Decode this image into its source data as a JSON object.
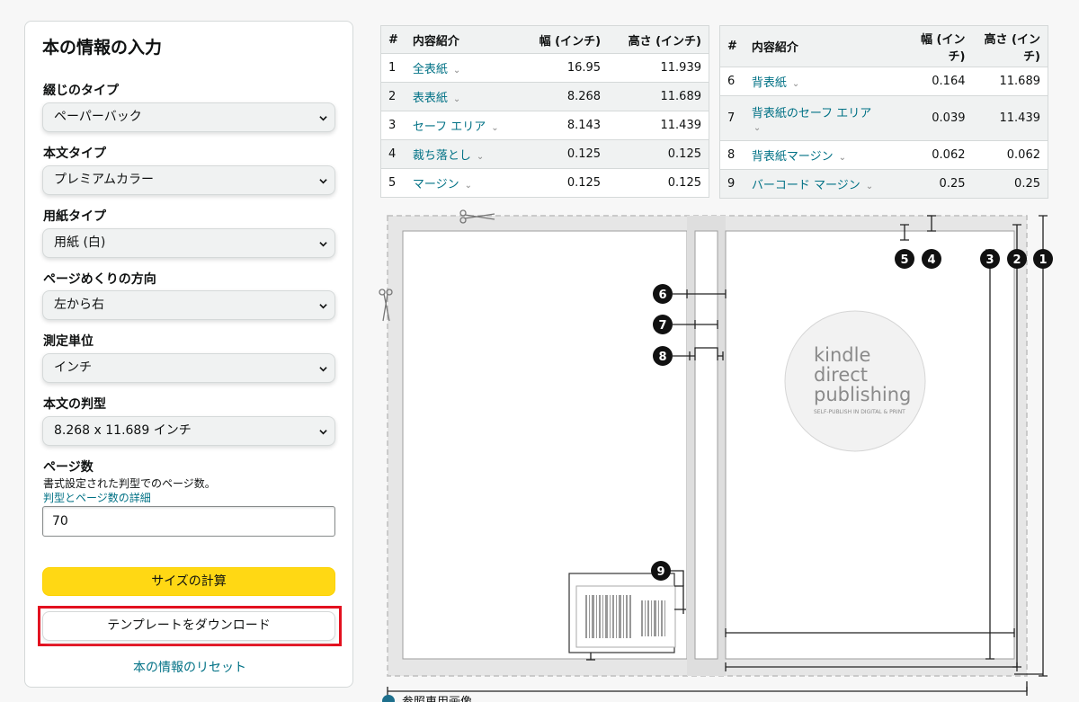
{
  "form": {
    "title": "本の情報の入力",
    "binding": {
      "label": "綴じのタイプ",
      "value": "ペーパーバック"
    },
    "interior": {
      "label": "本文タイプ",
      "value": "プレミアムカラー"
    },
    "paper": {
      "label": "用紙タイプ",
      "value": "用紙 (白)"
    },
    "direction": {
      "label": "ページめくりの方向",
      "value": "左から右"
    },
    "unit": {
      "label": "測定単位",
      "value": "インチ"
    },
    "trim": {
      "label": "本文の判型",
      "value": "8.268 x 11.689 インチ"
    },
    "pages": {
      "label": "ページ数",
      "hint": "書式設定された判型でのページ数。",
      "link": "判型とページ数の詳細",
      "value": "70"
    },
    "calc_button": "サイズの計算",
    "download_button": "テンプレートをダウンロード",
    "reset_link": "本の情報のリセット"
  },
  "table_headers": {
    "num": "#",
    "desc": "内容紹介",
    "width": "幅 (インチ)",
    "height": "高さ (インチ)"
  },
  "table_left": [
    {
      "n": "1",
      "label": "全表紙",
      "w": "16.95",
      "h": "11.939"
    },
    {
      "n": "2",
      "label": "表表紙",
      "w": "8.268",
      "h": "11.689"
    },
    {
      "n": "3",
      "label": "セーフ エリア",
      "w": "8.143",
      "h": "11.439"
    },
    {
      "n": "4",
      "label": "裁ち落とし",
      "w": "0.125",
      "h": "0.125"
    },
    {
      "n": "5",
      "label": "マージン",
      "w": "0.125",
      "h": "0.125"
    }
  ],
  "table_right": [
    {
      "n": "6",
      "label": "背表紙",
      "w": "0.164",
      "h": "11.689"
    },
    {
      "n": "7",
      "label": "背表紙のセーフ エリア",
      "w": "0.039",
      "h": "11.439"
    },
    {
      "n": "8",
      "label": "背表紙マージン",
      "w": "0.062",
      "h": "0.062"
    },
    {
      "n": "9",
      "label": "バーコード マージン",
      "w": "0.25",
      "h": "0.25"
    }
  ],
  "diagram": {
    "logo_line1": "kindle",
    "logo_line2": "direct",
    "logo_line3": "publishing",
    "logo_tag": "SELF-PUBLISH IN DIGITAL & PRINT",
    "markers": [
      "1",
      "2",
      "3",
      "4",
      "5",
      "6",
      "7",
      "8",
      "9"
    ],
    "footnote": "参照専用画像"
  },
  "colors": {
    "accent": "#ffd814",
    "link": "#007185",
    "highlight": "#e3101f"
  }
}
